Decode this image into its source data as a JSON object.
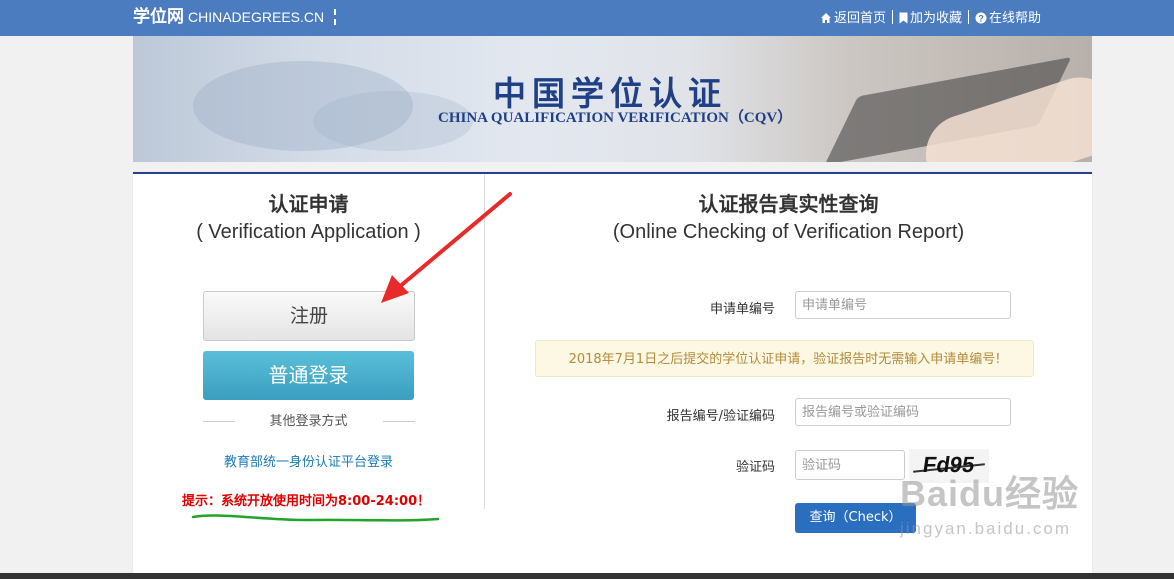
{
  "header": {
    "brand_cn": "学位网",
    "brand_en": "CHINADEGREES.CN",
    "links": [
      {
        "label": "返回首页",
        "icon": "home-icon"
      },
      {
        "label": "加为收藏",
        "icon": "bookmark-icon"
      },
      {
        "label": "在线帮助",
        "icon": "help-icon"
      }
    ]
  },
  "banner": {
    "title": "中国学位认证",
    "subtitle": "CHINA QUALIFICATION VERIFICATION（CQV）"
  },
  "left_panel": {
    "title": "认证申请",
    "subtitle": "( Verification Application )",
    "register_label": "注册",
    "login_label": "普通登录",
    "other_login_label": "其他登录方式",
    "moe_login_label": "教育部统一身份认证平台登录",
    "tip": "提示：系统开放使用时间为8:00-24:00！"
  },
  "right_panel": {
    "title": "认证报告真实性查询",
    "subtitle": "(Online Checking of Verification Report)",
    "application_no": {
      "label": "申请单编号",
      "placeholder": "申请单编号"
    },
    "notice": "2018年7月1日之后提交的学位认证申请，验证报告时无需输入申请单编号!",
    "report_no": {
      "label": "报告编号/验证编码",
      "placeholder": "报告编号或验证编码"
    },
    "captcha": {
      "label": "验证码",
      "placeholder": "验证码",
      "image_text": "Fd95"
    },
    "check_label": "查询（Check）"
  },
  "watermark": {
    "main": "Baidu经验",
    "url": "jingyan.baidu.com"
  },
  "colors": {
    "topbar": "#4c7cc0",
    "brand_blue": "#1f3f86",
    "login_button": "#3a9fc0",
    "check_button": "#2a6ebf",
    "tip_red": "#e00000",
    "arrow_red": "#e82a2a",
    "underline_green": "#22a32a"
  }
}
